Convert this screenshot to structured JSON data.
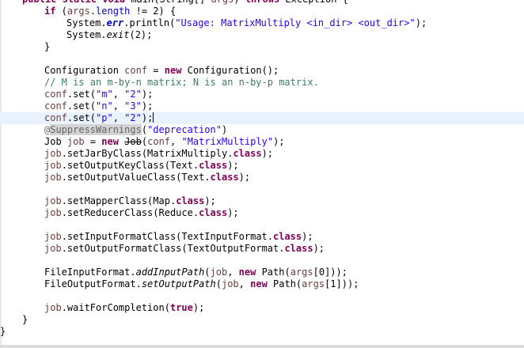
{
  "editor": {
    "language": "java",
    "caret_line": 10,
    "colors": {
      "keyword": "#7f0055",
      "string": "#2a00ff",
      "field": "#0000c0",
      "local_variable": "#6a3e3e",
      "comment": "#3f7f5f",
      "annotation": "#646464",
      "current_line_bg": "#e8f2fe"
    },
    "lines": [
      {
        "indent": 1,
        "tokens": [
          {
            "t": "public",
            "s": "kw"
          },
          {
            "t": " "
          },
          {
            "t": "static",
            "s": "kw"
          },
          {
            "t": " "
          },
          {
            "t": "void",
            "s": "kw"
          },
          {
            "t": " main(String[] "
          },
          {
            "t": "args",
            "s": "var"
          },
          {
            "t": ") "
          },
          {
            "t": "throws",
            "s": "kw"
          },
          {
            "t": " Exception {"
          }
        ]
      },
      {
        "indent": 2,
        "tokens": [
          {
            "t": "if",
            "s": "kw"
          },
          {
            "t": " ("
          },
          {
            "t": "args",
            "s": "var"
          },
          {
            "t": "."
          },
          {
            "t": "length",
            "s": "field"
          },
          {
            "t": " != 2) {"
          }
        ]
      },
      {
        "indent": 3,
        "tokens": [
          {
            "t": "System."
          },
          {
            "t": "err",
            "s": "bi field"
          },
          {
            "t": ".println("
          },
          {
            "t": "\"Usage: MatrixMultiply <in_dir> <out_dir>\"",
            "s": "str"
          },
          {
            "t": ");"
          }
        ]
      },
      {
        "indent": 3,
        "tokens": [
          {
            "t": "System."
          },
          {
            "t": "exit",
            "s": "ital"
          },
          {
            "t": "(2);"
          }
        ]
      },
      {
        "indent": 2,
        "tokens": [
          {
            "t": "}"
          }
        ]
      },
      {
        "indent": 0,
        "tokens": []
      },
      {
        "indent": 2,
        "tokens": [
          {
            "t": "Configuration "
          },
          {
            "t": "conf",
            "s": "var"
          },
          {
            "t": " = "
          },
          {
            "t": "new",
            "s": "kw"
          },
          {
            "t": " Configuration();"
          }
        ]
      },
      {
        "indent": 2,
        "tokens": [
          {
            "t": "// M is an m-by-n matrix; N is an n-by-p matrix.",
            "s": "cmt"
          }
        ]
      },
      {
        "indent": 2,
        "tokens": [
          {
            "t": "conf",
            "s": "var"
          },
          {
            "t": ".set("
          },
          {
            "t": "\"m\"",
            "s": "str"
          },
          {
            "t": ", "
          },
          {
            "t": "\"2\"",
            "s": "str"
          },
          {
            "t": ");"
          }
        ]
      },
      {
        "indent": 2,
        "tokens": [
          {
            "t": "conf",
            "s": "var"
          },
          {
            "t": ".set("
          },
          {
            "t": "\"n\"",
            "s": "str"
          },
          {
            "t": ", "
          },
          {
            "t": "\"3\"",
            "s": "str"
          },
          {
            "t": ");"
          }
        ]
      },
      {
        "indent": 2,
        "current": true,
        "tokens": [
          {
            "t": "conf",
            "s": "var"
          },
          {
            "t": ".set("
          },
          {
            "t": "\"p\"",
            "s": "str"
          },
          {
            "t": ", "
          },
          {
            "t": "\"2\"",
            "s": "str"
          },
          {
            "t": ");"
          }
        ]
      },
      {
        "indent": 2,
        "tokens": [
          {
            "t": "@",
            "s": "ann"
          },
          {
            "t": "SuppressWarnings",
            "s": "ann ann-hl"
          },
          {
            "t": "("
          },
          {
            "t": "\"deprecation\"",
            "s": "str"
          },
          {
            "t": ")"
          }
        ]
      },
      {
        "indent": 2,
        "tokens": [
          {
            "t": "Job "
          },
          {
            "t": "job",
            "s": "var"
          },
          {
            "t": " = "
          },
          {
            "t": "new",
            "s": "kw"
          },
          {
            "t": " "
          },
          {
            "t": "Job",
            "s": "strike"
          },
          {
            "t": "("
          },
          {
            "t": "conf",
            "s": "var"
          },
          {
            "t": ", "
          },
          {
            "t": "\"MatrixMultiply\"",
            "s": "str"
          },
          {
            "t": ");"
          }
        ]
      },
      {
        "indent": 2,
        "tokens": [
          {
            "t": "job",
            "s": "var"
          },
          {
            "t": ".setJarByClass(MatrixMultiply."
          },
          {
            "t": "class",
            "s": "kw"
          },
          {
            "t": ");"
          }
        ]
      },
      {
        "indent": 2,
        "tokens": [
          {
            "t": "job",
            "s": "var"
          },
          {
            "t": ".setOutputKeyClass(Text."
          },
          {
            "t": "class",
            "s": "kw"
          },
          {
            "t": ");"
          }
        ]
      },
      {
        "indent": 2,
        "tokens": [
          {
            "t": "job",
            "s": "var"
          },
          {
            "t": ".setOutputValueClass(Text."
          },
          {
            "t": "class",
            "s": "kw"
          },
          {
            "t": ");"
          }
        ]
      },
      {
        "indent": 0,
        "tokens": []
      },
      {
        "indent": 2,
        "tokens": [
          {
            "t": "job",
            "s": "var"
          },
          {
            "t": ".setMapperClass(Map."
          },
          {
            "t": "class",
            "s": "kw"
          },
          {
            "t": ");"
          }
        ]
      },
      {
        "indent": 2,
        "tokens": [
          {
            "t": "job",
            "s": "var"
          },
          {
            "t": ".setReducerClass(Reduce."
          },
          {
            "t": "class",
            "s": "kw"
          },
          {
            "t": ");"
          }
        ]
      },
      {
        "indent": 0,
        "tokens": []
      },
      {
        "indent": 2,
        "tokens": [
          {
            "t": "job",
            "s": "var"
          },
          {
            "t": ".setInputFormatClass(TextInputFormat."
          },
          {
            "t": "class",
            "s": "kw"
          },
          {
            "t": ");"
          }
        ]
      },
      {
        "indent": 2,
        "tokens": [
          {
            "t": "job",
            "s": "var"
          },
          {
            "t": ".setOutputFormatClass(TextOutputFormat."
          },
          {
            "t": "class",
            "s": "kw"
          },
          {
            "t": ");"
          }
        ]
      },
      {
        "indent": 0,
        "tokens": []
      },
      {
        "indent": 2,
        "tokens": [
          {
            "t": "FileInputFormat."
          },
          {
            "t": "addInputPath",
            "s": "ital"
          },
          {
            "t": "("
          },
          {
            "t": "job",
            "s": "var"
          },
          {
            "t": ", "
          },
          {
            "t": "new",
            "s": "kw"
          },
          {
            "t": " Path("
          },
          {
            "t": "args",
            "s": "var"
          },
          {
            "t": "[0]));"
          }
        ]
      },
      {
        "indent": 2,
        "tokens": [
          {
            "t": "FileOutputFormat."
          },
          {
            "t": "setOutputPath",
            "s": "ital"
          },
          {
            "t": "("
          },
          {
            "t": "job",
            "s": "var"
          },
          {
            "t": ", "
          },
          {
            "t": "new",
            "s": "kw"
          },
          {
            "t": " Path("
          },
          {
            "t": "args",
            "s": "var"
          },
          {
            "t": "[1]));"
          }
        ]
      },
      {
        "indent": 0,
        "tokens": []
      },
      {
        "indent": 2,
        "tokens": [
          {
            "t": "job",
            "s": "var"
          },
          {
            "t": ".waitForCompletion("
          },
          {
            "t": "true",
            "s": "kw"
          },
          {
            "t": ");"
          }
        ]
      },
      {
        "indent": 1,
        "tokens": [
          {
            "t": "}"
          }
        ]
      },
      {
        "indent": 0,
        "tokens": [
          {
            "t": "}"
          }
        ]
      }
    ]
  }
}
